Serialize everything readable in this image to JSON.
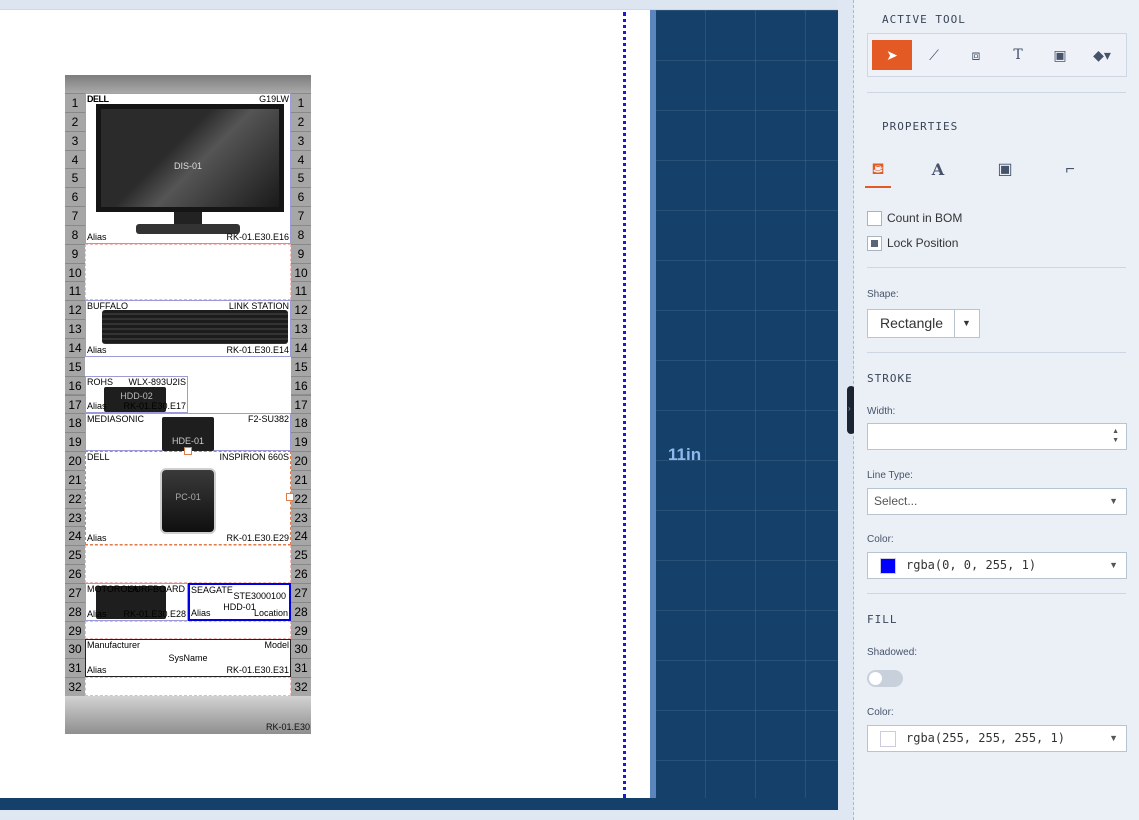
{
  "canvas": {
    "dimension_label": "11in",
    "rack": {
      "id_label": "RK-01.E30",
      "units": [
        "1",
        "2",
        "3",
        "4",
        "5",
        "6",
        "7",
        "8",
        "9",
        "10",
        "11",
        "12",
        "13",
        "14",
        "15",
        "16",
        "17",
        "18",
        "19",
        "20",
        "21",
        "22",
        "23",
        "24",
        "25",
        "26",
        "27",
        "28",
        "29",
        "30",
        "31",
        "32"
      ],
      "devices": {
        "monitor": {
          "mfr": "DELL",
          "model": "G19LW",
          "mid": "DIS-01",
          "alias": "Alias",
          "loc": "RK-01.E30.E16"
        },
        "nas": {
          "mfr": "BUFFALO",
          "model": "LINK STATION",
          "alias": "Alias",
          "loc": "RK-01.E30.E14"
        },
        "rohs": {
          "mfr": "ROHS",
          "model": "WLX-893U2IS",
          "mid": "HDD-02",
          "alias": "Alias",
          "loc": "RK-01.E30.E17"
        },
        "mediasonic": {
          "mfr": "MEDIASONIC",
          "model": "F2-SU382",
          "mid": "HDE-01"
        },
        "pc": {
          "mfr": "DELL",
          "model": "INSPIRION 660S",
          "mid": "PC-01",
          "alias": "Alias",
          "loc": "RK-01.E30.E29"
        },
        "motorola": {
          "mfr": "MOTOROLA",
          "model": "SURFBOARD",
          "alias": "Alias",
          "loc": "RK-01.E30.E28"
        },
        "seagate": {
          "mfr": "SEAGATE",
          "model": "STE3000100",
          "mid": "HDD-01",
          "alias": "Alias",
          "loc": "Location"
        },
        "template": {
          "mfr": "Manufacturer",
          "model": "Model",
          "mid": "SysName",
          "alias": "Alias",
          "loc": "RK-01.E30.E31"
        }
      }
    }
  },
  "panel": {
    "active_tool_title": "ACTIVE TOOL",
    "properties_title": "PROPERTIES",
    "count_in_bom": "Count in BOM",
    "lock_position": "Lock Position",
    "shape_label": "Shape:",
    "shape_value": "Rectangle",
    "stroke_title": "STROKE",
    "width_label": "Width:",
    "line_type_label": "Line Type:",
    "line_type_placeholder": "Select...",
    "color_label": "Color:",
    "stroke_color": "rgba(0, 0, 255, 1)",
    "stroke_swatch": "#0000ff",
    "fill_title": "FILL",
    "shadowed_label": "Shadowed:",
    "fill_color_label": "Color:",
    "fill_color": "rgba(255, 255, 255, 1)",
    "fill_swatch": "#ffffff",
    "accent_color": "#e35a25"
  }
}
